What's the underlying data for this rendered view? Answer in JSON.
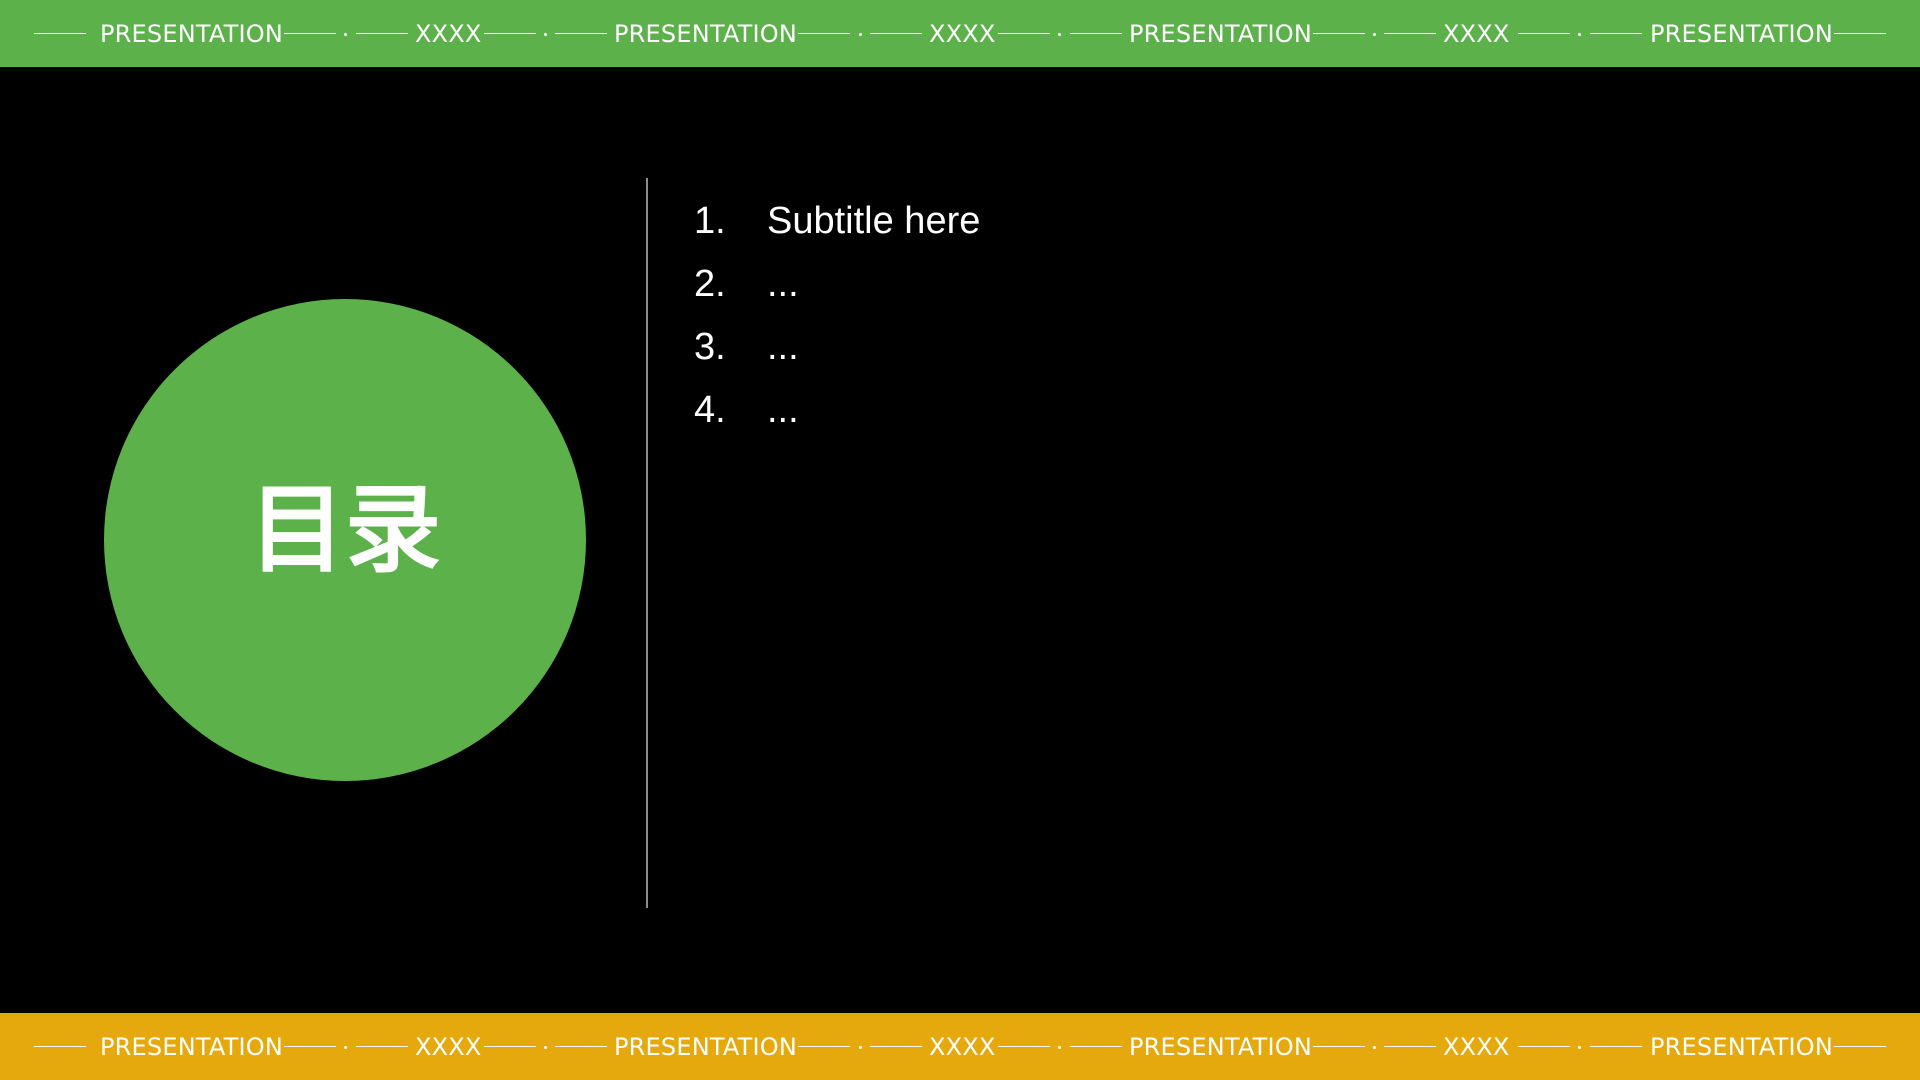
{
  "colors": {
    "background": "#000000",
    "top_banner": "#5cb14b",
    "bottom_banner": "#e6a90d",
    "circle": "#5cb14b",
    "text": "#ffffff",
    "divider": "#8c8c8c"
  },
  "banner": {
    "words": [
      "PRESENTATION",
      "XXXX",
      "PRESENTATION",
      "XXXX",
      "PRESENTATION",
      "XXXX",
      "PRESENTATION"
    ]
  },
  "circle": {
    "title": "目录"
  },
  "toc": {
    "items": [
      {
        "num": "1.",
        "text": "Subtitle here"
      },
      {
        "num": "2.",
        "text": "..."
      },
      {
        "num": "3.",
        "text": "..."
      },
      {
        "num": "4.",
        "text": "..."
      }
    ]
  }
}
